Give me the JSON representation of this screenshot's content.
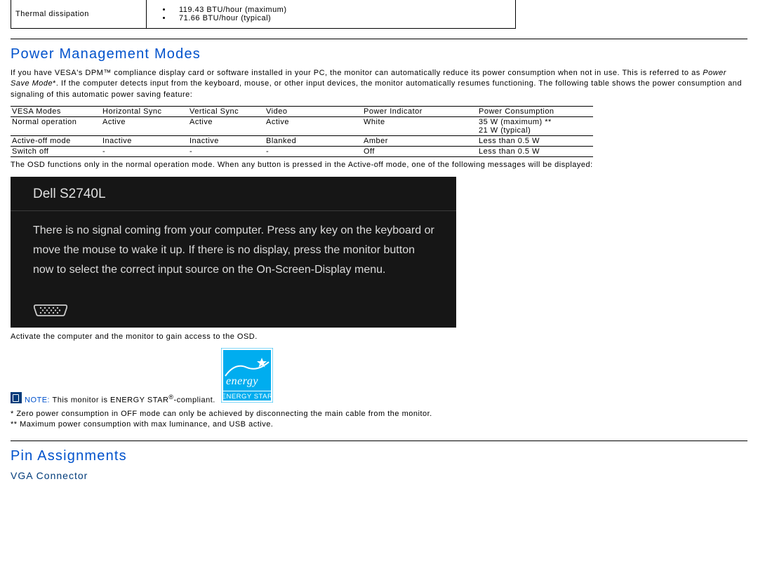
{
  "thermal": {
    "label": "Thermal dissipation",
    "max": "119.43 BTU/hour (maximum)",
    "typ": "71.66 BTU/hour (typical)"
  },
  "section1": {
    "title": "Power Management Modes",
    "intro_a": "If you have VESA's DPM™ compliance display card or software installed in your PC, the monitor can automatically reduce its power consumption when not in use. This is referred to as ",
    "intro_em": "Power Save Mode",
    "intro_b": "*. If the computer detects input from the keyboard, mouse, or other input devices, the monitor automatically resumes functioning. The following table shows the power consumption and signaling of this automatic power saving feature:",
    "tbl": {
      "h1": "VESA Modes",
      "h2": "Horizontal Sync",
      "h3": "Vertical Sync",
      "h4": "Video",
      "h5": "Power Indicator",
      "h6": "Power Consumption",
      "r1": {
        "c1": "Normal operation",
        "c2": "Active",
        "c3": "Active",
        "c4": "Active",
        "c5": "White",
        "c6a": "35 W (maximum) **",
        "c6b": "21 W (typical)"
      },
      "r2": {
        "c1": "Active-off mode",
        "c2": "Inactive",
        "c3": "Inactive",
        "c4": "Blanked",
        "c5": "Amber",
        "c6": "Less than 0.5 W"
      },
      "r3": {
        "c1": "Switch off",
        "c2": "-",
        "c3": "-",
        "c4": "-",
        "c5": "Off",
        "c6": "Less than 0.5 W"
      }
    },
    "osd_note": "The OSD functions only in the normal operation mode. When any button is pressed in the Active-off mode, one of the following messages will be displayed:",
    "osd": {
      "title": "Dell S2740L",
      "msg": "There is no signal coming from your computer. Press any key on the keyboard or move the mouse to wake it up. If there is no display, press the monitor button now to select the correct input source on the On-Screen-Display menu."
    },
    "activate": "Activate the computer and the monitor to gain access to the OSD.",
    "note_label": "NOTE:",
    "note_text": " This monitor is ENERGY STAR",
    "note_tail": "-compliant.",
    "es_top": "energy",
    "es_bottom": "ENERGY STAR",
    "fn1": "*   Zero power consumption in OFF mode can only be achieved by disconnecting the main cable from the monitor.",
    "fn2": "** Maximum power consumption with max luminance, and USB active."
  },
  "section2": {
    "title": "Pin Assignments",
    "sub": "VGA Connector"
  }
}
